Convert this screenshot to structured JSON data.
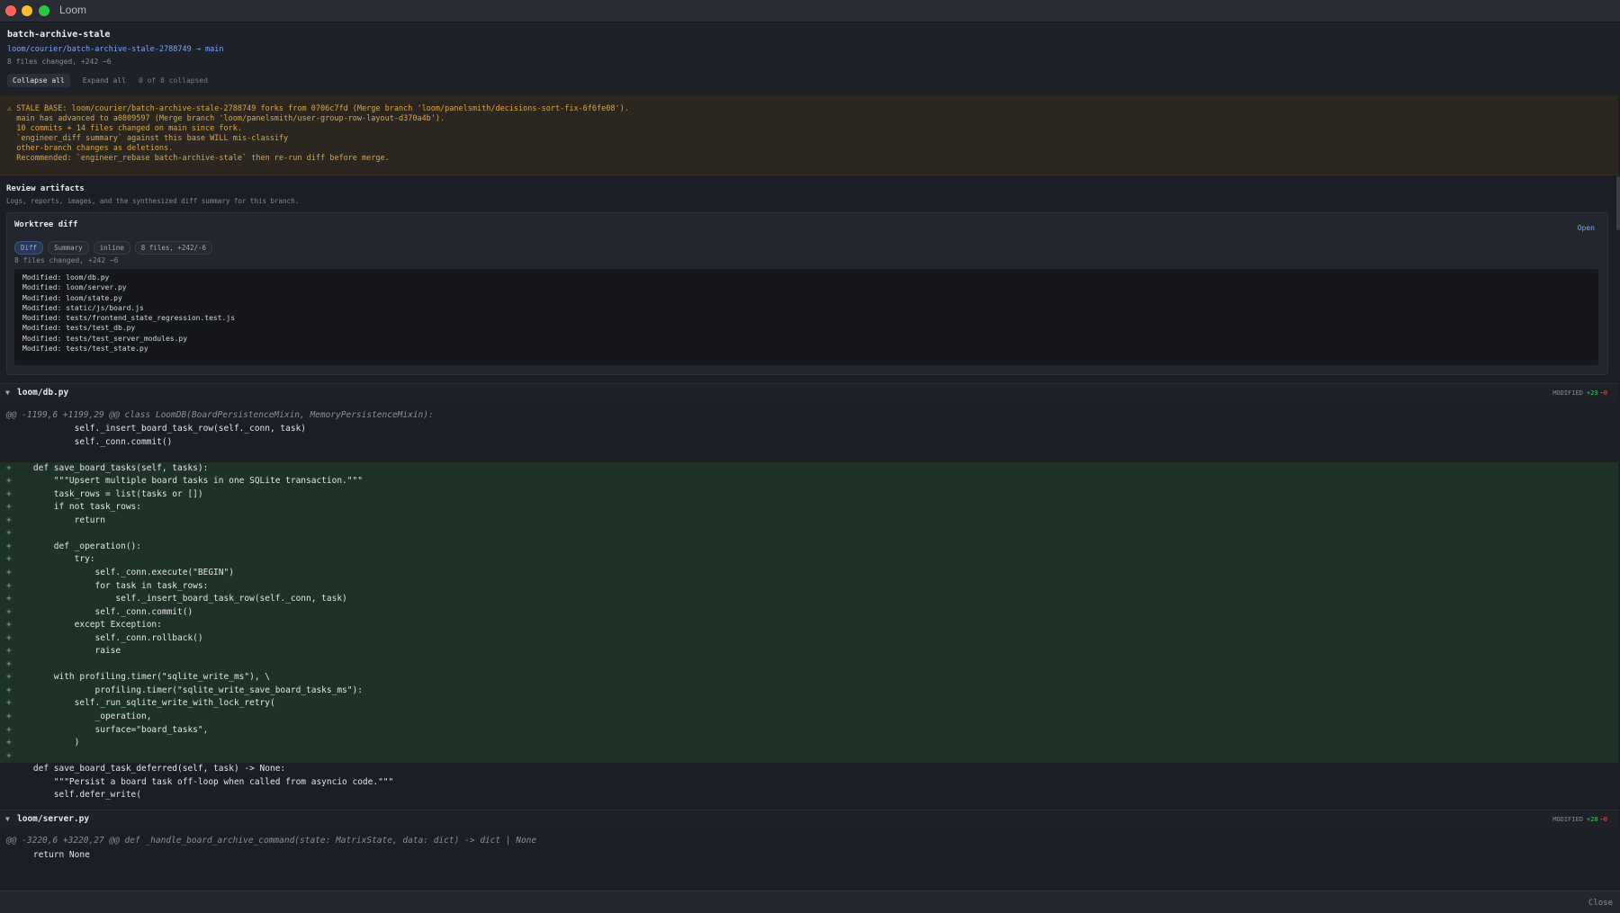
{
  "window": {
    "title": "Loom"
  },
  "header": {
    "title": "batch-archive-stale",
    "branch": "loom/courier/batch-archive-stale-2788749 → main",
    "stats": "8 files changed, +242 −6",
    "collapse_all": "Collapse all",
    "expand_all": "Expand all",
    "collapsed_note": "0 of 8 collapsed"
  },
  "warning": {
    "lines": [
      "⚠ STALE BASE: loom/courier/batch-archive-stale-2788749 forks from 0706c7fd (Merge branch 'loom/panelsmith/decisions-sort-fix-6f6fe08').",
      "  main has advanced to a0809597 (Merge branch 'loom/panelsmith/user-group-row-layout-d370a4b').",
      "  10 commits + 14 files changed on main since fork.",
      "  `engineer_diff summary` against this base WILL mis-classify",
      "  other-branch changes as deletions.",
      "  Recommended: `engineer_rebase batch-archive-stale` then re-run diff before merge."
    ]
  },
  "artifacts": {
    "title": "Review artifacts",
    "subtitle": "Logs, reports, images, and the synthesized diff summary for this branch.",
    "card": {
      "title": "Worktree diff",
      "open": "Open",
      "chips": [
        "Diff",
        "Summary",
        "inline",
        "8 files, +242/-6"
      ],
      "stats": "8 files changed, +242 −6",
      "files": [
        "Modified: loom/db.py",
        "Modified: loom/server.py",
        "Modified: loom/state.py",
        "Modified: static/js/board.js",
        "Modified: tests/frontend_state_regression.test.js",
        "Modified: tests/test_db.py",
        "Modified: tests/test_server_modules.py",
        "Modified: tests/test_state.py"
      ]
    }
  },
  "diff1": {
    "filename": "loom/db.py",
    "status": "MODIFIED",
    "added": "+23",
    "removed": "−0",
    "hunk": "@@ -1199,6 +1199,29 @@ class LoomDB(BoardPersistenceMixin, MemoryPersistenceMixin):",
    "lines": [
      {
        "t": " ",
        "c": "            self._insert_board_task_row(self._conn, task)"
      },
      {
        "t": " ",
        "c": "            self._conn.commit()"
      },
      {
        "t": " ",
        "c": ""
      },
      {
        "t": "+",
        "c": "    def save_board_tasks(self, tasks):"
      },
      {
        "t": "+",
        "c": "        \"\"\"Upsert multiple board tasks in one SQLite transaction.\"\"\""
      },
      {
        "t": "+",
        "c": "        task_rows = list(tasks or [])"
      },
      {
        "t": "+",
        "c": "        if not task_rows:"
      },
      {
        "t": "+",
        "c": "            return"
      },
      {
        "t": "+",
        "c": ""
      },
      {
        "t": "+",
        "c": "        def _operation():"
      },
      {
        "t": "+",
        "c": "            try:"
      },
      {
        "t": "+",
        "c": "                self._conn.execute(\"BEGIN\")"
      },
      {
        "t": "+",
        "c": "                for task in task_rows:"
      },
      {
        "t": "+",
        "c": "                    self._insert_board_task_row(self._conn, task)"
      },
      {
        "t": "+",
        "c": "                self._conn.commit()"
      },
      {
        "t": "+",
        "c": "            except Exception:"
      },
      {
        "t": "+",
        "c": "                self._conn.rollback()"
      },
      {
        "t": "+",
        "c": "                raise"
      },
      {
        "t": "+",
        "c": ""
      },
      {
        "t": "+",
        "c": "        with profiling.timer(\"sqlite_write_ms\"), \\"
      },
      {
        "t": "+",
        "c": "                profiling.timer(\"sqlite_write_save_board_tasks_ms\"):"
      },
      {
        "t": "+",
        "c": "            self._run_sqlite_write_with_lock_retry("
      },
      {
        "t": "+",
        "c": "                _operation,"
      },
      {
        "t": "+",
        "c": "                surface=\"board_tasks\","
      },
      {
        "t": "+",
        "c": "            )"
      },
      {
        "t": "+",
        "c": ""
      },
      {
        "t": " ",
        "c": "    def save_board_task_deferred(self, task) -> None:"
      },
      {
        "t": " ",
        "c": "        \"\"\"Persist a board task off-loop when called from asyncio code.\"\"\""
      },
      {
        "t": " ",
        "c": "        self.defer_write("
      }
    ]
  },
  "diff2": {
    "filename": "loom/server.py",
    "status": "MODIFIED",
    "added": "+28",
    "removed": "−0",
    "hunk": "@@ -3220,6 +3220,27 @@ def _handle_board_archive_command(state: MatrixState, data: dict) -> dict | None",
    "lines": [
      {
        "t": " ",
        "c": "    return None"
      }
    ]
  },
  "footer": {
    "close": "Close"
  }
}
